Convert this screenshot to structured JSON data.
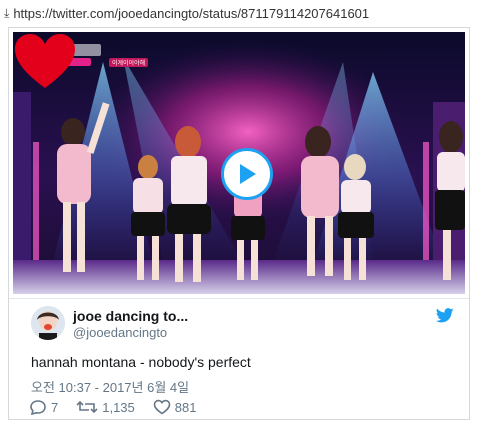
{
  "url": {
    "text": "https://twitter.com/jooedancingto/status/871179114207641601"
  },
  "video": {
    "stage_badge": "이게이이야해"
  },
  "tweet": {
    "display_name": "jooe dancing to...",
    "handle": "@jooedancingto",
    "text": "hannah montana - nobody's perfect",
    "timestamp": "오전 10:37 - 2017년 6월 4일",
    "replies": "7",
    "retweets": "1,135",
    "likes": "881"
  },
  "colors": {
    "twitter_blue": "#1da1f2",
    "heart": "#e3001b",
    "muted": "#657786"
  },
  "icons": [
    "download-arrow-icon",
    "play-icon",
    "heart-icon",
    "twitter-bird-icon",
    "reply-icon",
    "retweet-icon",
    "like-icon"
  ]
}
